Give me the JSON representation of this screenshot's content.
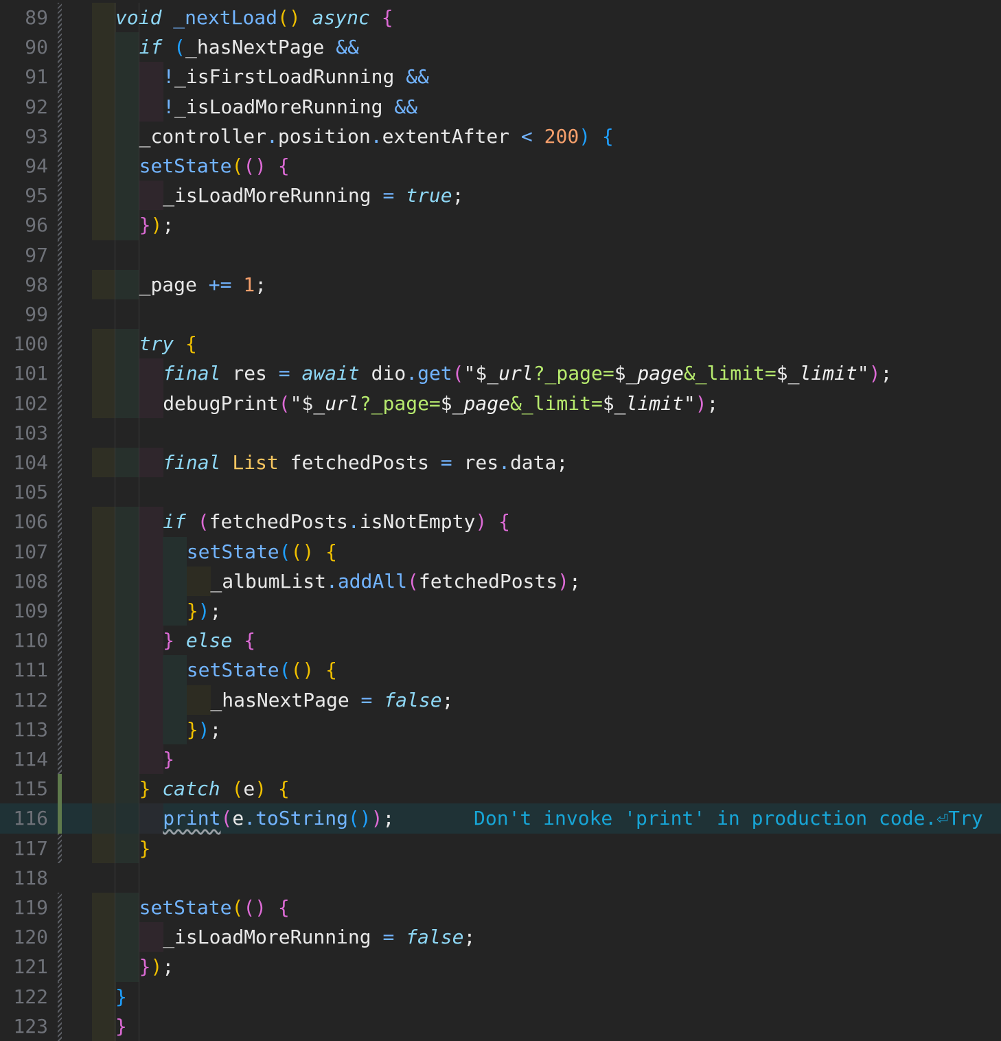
{
  "editor": {
    "line_numbers": [
      "89",
      "90",
      "91",
      "92",
      "93",
      "94",
      "95",
      "96",
      "97",
      "98",
      "99",
      "100",
      "101",
      "102",
      "103",
      "104",
      "105",
      "106",
      "107",
      "108",
      "109",
      "110",
      "111",
      "112",
      "113",
      "114",
      "115",
      "116",
      "117",
      "118",
      "119",
      "120",
      "121",
      "122",
      "123"
    ],
    "lines": [
      [
        [
          "kw",
          "void"
        ],
        [
          "id",
          " "
        ],
        [
          "fn",
          "_nextLoad"
        ],
        [
          "b1",
          "()"
        ],
        [
          "id",
          " "
        ],
        [
          "kw",
          "async"
        ],
        [
          "id",
          " "
        ],
        [
          "b2",
          "{"
        ]
      ],
      [
        [
          "kw",
          "if"
        ],
        [
          "id",
          " "
        ],
        [
          "b3",
          "("
        ],
        [
          "id",
          "_hasNextPage "
        ],
        [
          "op",
          "&&"
        ]
      ],
      [
        [
          "op",
          "!"
        ],
        [
          "id",
          "_isFirstLoadRunning "
        ],
        [
          "op",
          "&&"
        ]
      ],
      [
        [
          "op",
          "!"
        ],
        [
          "id",
          "_isLoadMoreRunning "
        ],
        [
          "op",
          "&&"
        ]
      ],
      [
        [
          "id",
          "_controller"
        ],
        [
          "op",
          "."
        ],
        [
          "id",
          "position"
        ],
        [
          "op",
          "."
        ],
        [
          "id",
          "extentAfter "
        ],
        [
          "op",
          "<"
        ],
        [
          "id",
          " "
        ],
        [
          "num",
          "200"
        ],
        [
          "b3",
          ")"
        ],
        [
          "id",
          " "
        ],
        [
          "b3",
          "{"
        ]
      ],
      [
        [
          "fn",
          "setState"
        ],
        [
          "b1",
          "("
        ],
        [
          "b2",
          "()"
        ],
        [
          "id",
          " "
        ],
        [
          "b2",
          "{"
        ]
      ],
      [
        [
          "id",
          "_isLoadMoreRunning "
        ],
        [
          "op",
          "="
        ],
        [
          "id",
          " "
        ],
        [
          "kw",
          "true"
        ],
        [
          "id",
          ";"
        ]
      ],
      [
        [
          "b2",
          "}"
        ],
        [
          "b1",
          ")"
        ],
        [
          "id",
          ";"
        ]
      ],
      [],
      [
        [
          "id",
          "_page "
        ],
        [
          "op",
          "+="
        ],
        [
          "id",
          " "
        ],
        [
          "num",
          "1"
        ],
        [
          "id",
          ";"
        ]
      ],
      [],
      [
        [
          "kw",
          "try"
        ],
        [
          "id",
          " "
        ],
        [
          "b1",
          "{"
        ]
      ],
      [
        [
          "kw",
          "final"
        ],
        [
          "id",
          " res "
        ],
        [
          "op",
          "="
        ],
        [
          "id",
          " "
        ],
        [
          "kw",
          "await"
        ],
        [
          "id",
          " dio"
        ],
        [
          "op",
          "."
        ],
        [
          "fn",
          "get"
        ],
        [
          "b2",
          "("
        ],
        [
          "id",
          "\"$"
        ],
        [
          "interp",
          "_url"
        ],
        [
          "str",
          "?_page="
        ],
        [
          "id",
          "$"
        ],
        [
          "interp",
          "_page"
        ],
        [
          "str",
          "&_limit="
        ],
        [
          "id",
          "$"
        ],
        [
          "interp",
          "_limit"
        ],
        [
          "id",
          "\""
        ],
        [
          "b2",
          ")"
        ],
        [
          "id",
          ";"
        ]
      ],
      [
        [
          "id",
          "debugPrint"
        ],
        [
          "b2",
          "("
        ],
        [
          "id",
          "\"$"
        ],
        [
          "interp",
          "_url"
        ],
        [
          "str",
          "?_page="
        ],
        [
          "id",
          "$"
        ],
        [
          "interp",
          "_page"
        ],
        [
          "str",
          "&_limit="
        ],
        [
          "id",
          "$"
        ],
        [
          "interp",
          "_limit"
        ],
        [
          "id",
          "\""
        ],
        [
          "b2",
          ")"
        ],
        [
          "id",
          ";"
        ]
      ],
      [],
      [
        [
          "kw",
          "final"
        ],
        [
          "id",
          " "
        ],
        [
          "ty",
          "List"
        ],
        [
          "id",
          " fetchedPosts "
        ],
        [
          "op",
          "="
        ],
        [
          "id",
          " res"
        ],
        [
          "op",
          "."
        ],
        [
          "id",
          "data;"
        ]
      ],
      [],
      [
        [
          "kw",
          "if"
        ],
        [
          "id",
          " "
        ],
        [
          "b2",
          "("
        ],
        [
          "id",
          "fetchedPosts"
        ],
        [
          "op",
          "."
        ],
        [
          "id",
          "isNotEmpty"
        ],
        [
          "b2",
          ")"
        ],
        [
          "id",
          " "
        ],
        [
          "b2",
          "{"
        ]
      ],
      [
        [
          "fn",
          "setState"
        ],
        [
          "b3",
          "("
        ],
        [
          "b1",
          "()"
        ],
        [
          "id",
          " "
        ],
        [
          "b1",
          "{"
        ]
      ],
      [
        [
          "id",
          "_albumList"
        ],
        [
          "op",
          "."
        ],
        [
          "fn",
          "addAll"
        ],
        [
          "b2",
          "("
        ],
        [
          "id",
          "fetchedPosts"
        ],
        [
          "b2",
          ")"
        ],
        [
          "id",
          ";"
        ]
      ],
      [
        [
          "b1",
          "}"
        ],
        [
          "b3",
          ")"
        ],
        [
          "id",
          ";"
        ]
      ],
      [
        [
          "b2",
          "}"
        ],
        [
          "id",
          " "
        ],
        [
          "kw",
          "else"
        ],
        [
          "id",
          " "
        ],
        [
          "b2",
          "{"
        ]
      ],
      [
        [
          "fn",
          "setState"
        ],
        [
          "b3",
          "("
        ],
        [
          "b1",
          "()"
        ],
        [
          "id",
          " "
        ],
        [
          "b1",
          "{"
        ]
      ],
      [
        [
          "id",
          "_hasNextPage "
        ],
        [
          "op",
          "="
        ],
        [
          "id",
          " "
        ],
        [
          "kw",
          "false"
        ],
        [
          "id",
          ";"
        ]
      ],
      [
        [
          "b1",
          "}"
        ],
        [
          "b3",
          ")"
        ],
        [
          "id",
          ";"
        ]
      ],
      [
        [
          "b2",
          "}"
        ]
      ],
      [
        [
          "b1",
          "}"
        ],
        [
          "id",
          " "
        ],
        [
          "kw",
          "catch"
        ],
        [
          "id",
          " "
        ],
        [
          "b1",
          "("
        ],
        [
          "id",
          "e"
        ],
        [
          "b1",
          ")"
        ],
        [
          "id",
          " "
        ],
        [
          "b1",
          "{"
        ]
      ],
      [
        [
          "fn",
          "print",
          "squiggle"
        ],
        [
          "b2",
          "("
        ],
        [
          "id",
          "e"
        ],
        [
          "op",
          "."
        ],
        [
          "fn",
          "toString"
        ],
        [
          "b3",
          "()"
        ],
        [
          "b2",
          ")"
        ],
        [
          "id",
          ";"
        ]
      ],
      [
        [
          "b1",
          "}"
        ]
      ],
      [],
      [
        [
          "fn",
          "setState"
        ],
        [
          "b1",
          "("
        ],
        [
          "b2",
          "()"
        ],
        [
          "id",
          " "
        ],
        [
          "b2",
          "{"
        ]
      ],
      [
        [
          "id",
          "_isLoadMoreRunning "
        ],
        [
          "op",
          "="
        ],
        [
          "id",
          " "
        ],
        [
          "kw",
          "false"
        ],
        [
          "id",
          ";"
        ]
      ],
      [
        [
          "b2",
          "}"
        ],
        [
          "b1",
          ")"
        ],
        [
          "id",
          ";"
        ]
      ],
      [
        [
          "b3",
          "}"
        ]
      ],
      [
        [
          "b2",
          "}"
        ]
      ]
    ],
    "diagnostic": {
      "line": "116",
      "message": "Don't invoke 'print' in production code.",
      "icon": "⏎",
      "suffix": "Try"
    },
    "colors": {
      "background": "#242424",
      "current_line": "#1f3236",
      "line_number": "#6e7178",
      "keyword": "#8ed7f5",
      "function": "#72b4ff",
      "number": "#f7a06c",
      "string": "#b7ea6e",
      "type": "#f8c660",
      "hint": "#17a5d6",
      "modified_marker": "#5f7a4c"
    }
  }
}
